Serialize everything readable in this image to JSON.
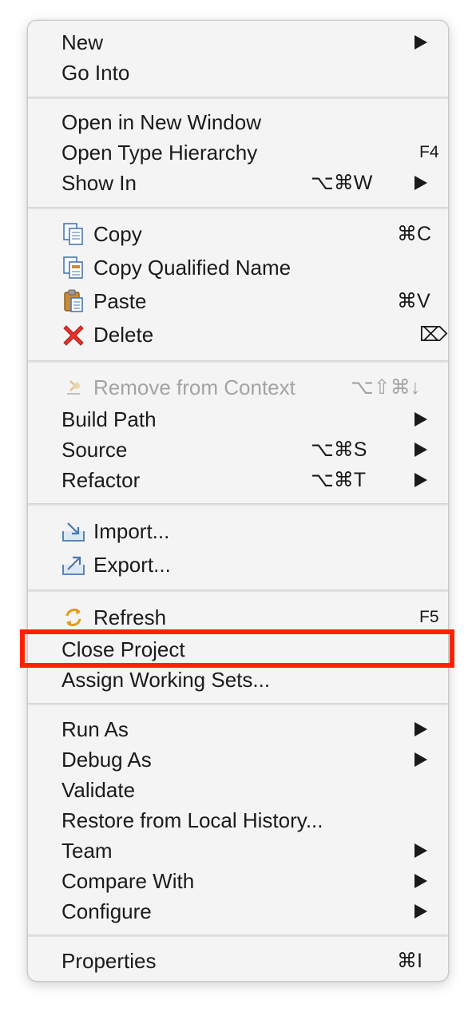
{
  "menu": {
    "new": {
      "label": "New"
    },
    "go_into": {
      "label": "Go Into"
    },
    "open_new_window": {
      "label": "Open in New Window"
    },
    "open_type_hierarchy": {
      "label": "Open Type Hierarchy",
      "shortcut": "F4"
    },
    "show_in": {
      "label": "Show In",
      "shortcut": "⌥⌘W"
    },
    "copy": {
      "label": "Copy",
      "shortcut": "⌘C",
      "icon": "copy-icon"
    },
    "copy_qualified": {
      "label": "Copy Qualified Name",
      "icon": "copy-qualified-name-icon"
    },
    "paste": {
      "label": "Paste",
      "shortcut": "⌘V",
      "icon": "paste-icon"
    },
    "delete": {
      "label": "Delete",
      "shortcut": "⌦",
      "icon": "delete-icon"
    },
    "remove_context": {
      "label": "Remove from Context",
      "shortcut": "⌥⇧⌘↓",
      "icon": "remove-from-context-icon",
      "disabled": true
    },
    "build_path": {
      "label": "Build Path"
    },
    "source": {
      "label": "Source",
      "shortcut": "⌥⌘S"
    },
    "refactor": {
      "label": "Refactor",
      "shortcut": "⌥⌘T"
    },
    "import": {
      "label": "Import...",
      "icon": "import-icon"
    },
    "export": {
      "label": "Export...",
      "icon": "export-icon"
    },
    "refresh": {
      "label": "Refresh",
      "shortcut": "F5",
      "icon": "refresh-icon"
    },
    "close_project": {
      "label": "Close Project"
    },
    "assign_working_sets": {
      "label": "Assign Working Sets..."
    },
    "run_as": {
      "label": "Run As"
    },
    "debug_as": {
      "label": "Debug As"
    },
    "validate": {
      "label": "Validate"
    },
    "restore_history": {
      "label": "Restore from Local History..."
    },
    "team": {
      "label": "Team"
    },
    "compare_with": {
      "label": "Compare With"
    },
    "configure": {
      "label": "Configure"
    },
    "properties": {
      "label": "Properties",
      "shortcut": "⌘I"
    }
  },
  "colors": {
    "menu_background": "#f4f4f4",
    "text": "#1a1a1a",
    "disabled_text": "#a3a3a3",
    "highlight_box": "#ff2200",
    "delete_icon": "#e8322b"
  }
}
